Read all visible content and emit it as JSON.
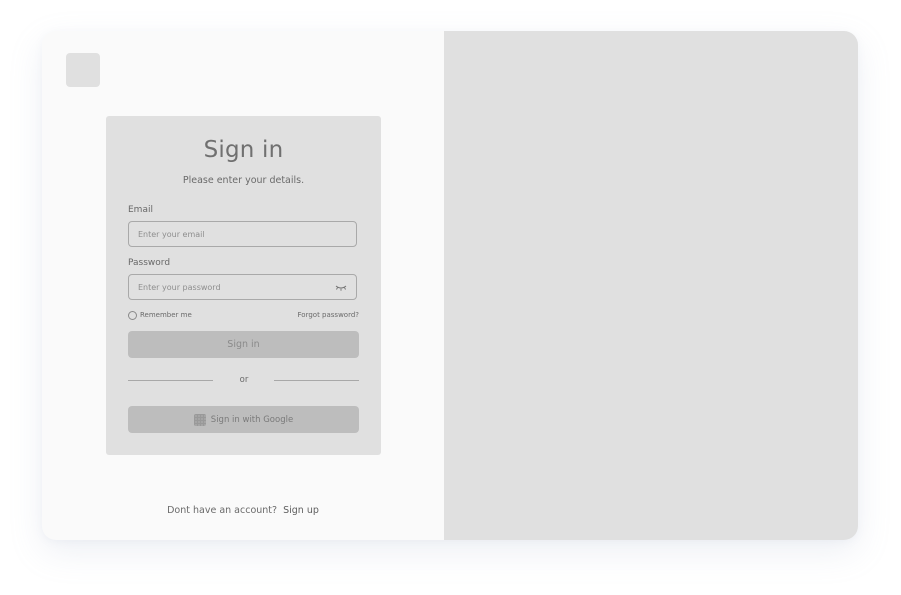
{
  "signin": {
    "title": "Sign in",
    "subtitle": "Please enter your details.",
    "email_label": "Email",
    "email_placeholder": "Enter your email",
    "email_value": "",
    "password_label": "Password",
    "password_placeholder": "Enter your password",
    "password_value": "",
    "remember_label": "Remember me",
    "forgot_label": "Forgot password?",
    "submit_label": "Sign in",
    "divider_label": "or",
    "google_label": "Sign in with Google"
  },
  "footer": {
    "prompt": "Dont have an account?",
    "signup_label": "Sign up"
  },
  "icons": {
    "logo": "logo-placeholder",
    "eye": "eye-closed-icon",
    "google": "google-icon"
  },
  "colors": {
    "frame_bg": "#fafafa",
    "panel_bg": "#e0e0e0",
    "button_bg": "#bdbdbd"
  }
}
